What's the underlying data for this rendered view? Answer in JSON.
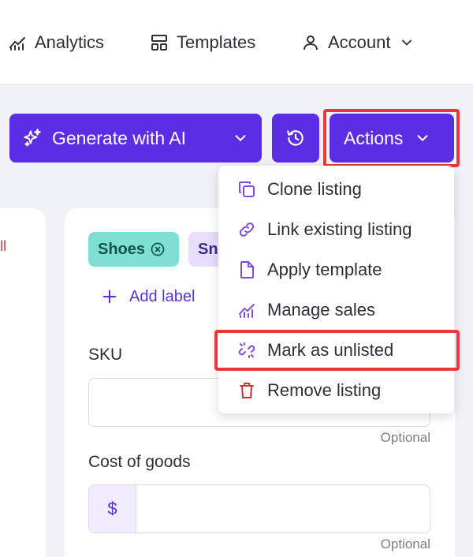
{
  "nav": {
    "analytics": "Analytics",
    "templates": "Templates",
    "account": "Account"
  },
  "toolbar": {
    "generate_label": "Generate with AI",
    "actions_label": "Actions"
  },
  "left_fragment": "ll",
  "labels": {
    "chips": [
      "Shoes",
      "Sn"
    ],
    "add_label": "Add label"
  },
  "fields": {
    "sku_label": "SKU",
    "sku_value": "",
    "sku_hint": "Optional",
    "cost_label": "Cost of goods",
    "cost_prefix": "$",
    "cost_value": "",
    "cost_hint": "Optional"
  },
  "actions_menu": {
    "items": [
      {
        "label": "Clone listing",
        "icon": "clone-icon"
      },
      {
        "label": "Link existing listing",
        "icon": "link-icon"
      },
      {
        "label": "Apply template",
        "icon": "file-icon"
      },
      {
        "label": "Manage sales",
        "icon": "chart-icon"
      },
      {
        "label": "Mark as unlisted",
        "icon": "unlink-icon"
      },
      {
        "label": "Remove listing",
        "icon": "trash-icon"
      }
    ]
  },
  "colors": {
    "accent": "#5b2ee6",
    "highlight": "#e8383d",
    "danger": "#d32f2f",
    "chip_teal": "#7ee0d3",
    "chip_lavender": "#e6defc"
  }
}
